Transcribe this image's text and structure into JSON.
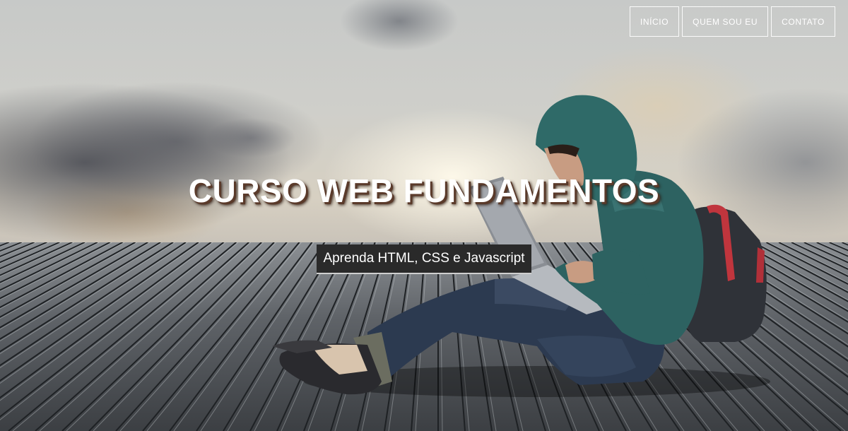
{
  "nav": {
    "items": [
      {
        "label": "INÍCIO"
      },
      {
        "label": "QUEM SOU EU"
      },
      {
        "label": "CONTATO"
      }
    ]
  },
  "hero": {
    "title": "CURSO WEB FUNDAMENTOS",
    "subtitle": "Aprenda HTML, CSS e Javascript"
  }
}
